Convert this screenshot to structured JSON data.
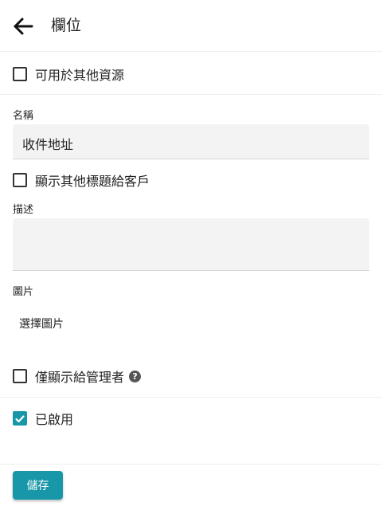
{
  "header": {
    "title": "欄位",
    "back_icon": "arrow-left-icon"
  },
  "options": {
    "available_other_resources": {
      "label": "可用於其他資源",
      "checked": false
    },
    "show_other_title": {
      "label": "顯示其他標題給客戶",
      "checked": false
    },
    "admin_only": {
      "label": "僅顯示給管理者",
      "checked": false,
      "help_icon": "question-circle-icon"
    },
    "enabled": {
      "label": "已啟用",
      "checked": true
    }
  },
  "fields": {
    "name": {
      "label": "名稱",
      "value": "收件地址"
    },
    "description": {
      "label": "描述",
      "value": ""
    },
    "image": {
      "label": "圖片",
      "action": "選擇圖片"
    }
  },
  "footer": {
    "save_label": "儲存"
  },
  "colors": {
    "accent": "#1797a8",
    "input_bg": "#f3f3f3"
  }
}
